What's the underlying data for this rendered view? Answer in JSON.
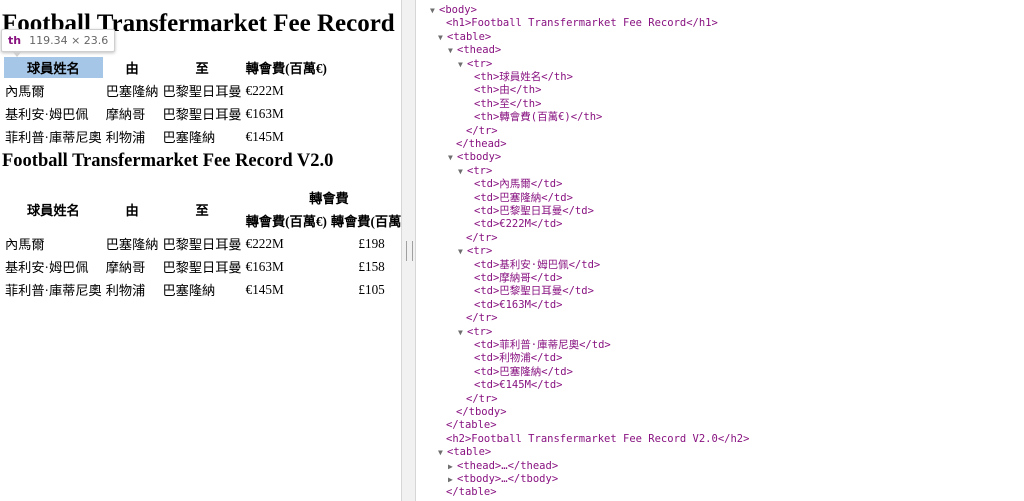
{
  "page": {
    "h1": "Football Transfermarket Fee Record",
    "h2": "Football Transfermarket Fee Record V2.0",
    "tooltip": {
      "tag": "th",
      "dims": "119.34 × 23.6"
    },
    "table1": {
      "headers": [
        "球員姓名",
        "由",
        "至",
        "轉會費(百萬€)"
      ],
      "rows": [
        [
          "內馬爾",
          "巴塞隆納",
          "巴黎聖日耳曼",
          "€222M"
        ],
        [
          "基利安·姆巴佩",
          "摩納哥",
          "巴黎聖日耳曼",
          "€163M"
        ],
        [
          "菲利普·庫蒂尼奧",
          "利物浦",
          "巴塞隆納",
          "€145M"
        ]
      ]
    },
    "table2": {
      "headers": [
        "球員姓名",
        "由",
        "至",
        "轉會費"
      ],
      "subheaders": [
        "轉會費(百萬€)",
        "轉會費(百萬£)"
      ],
      "rows": [
        [
          "內馬爾",
          "巴塞隆納",
          "巴黎聖日耳曼",
          "€222M",
          "£198"
        ],
        [
          "基利安·姆巴佩",
          "摩納哥",
          "巴黎聖日耳曼",
          "€163M",
          "£158"
        ],
        [
          "菲利普·庫蒂尼奧",
          "利物浦",
          "巴塞隆納",
          "€145M",
          "£105"
        ]
      ]
    }
  },
  "devtools": {
    "lines": [
      "<body>",
      "<h1>Football Transfermarket Fee Record</h1>",
      "<table>",
      "<thead>",
      "<tr>",
      "<th>球員姓名</th>",
      "<th>由</th>",
      "<th>至</th>",
      "<th>轉會費(百萬€)</th>",
      "</tr>",
      "</thead>",
      "<tbody>",
      "<tr>",
      "<td>內馬爾</td>",
      "<td>巴塞隆納</td>",
      "<td>巴黎聖日耳曼</td>",
      "<td>€222M</td>",
      "</tr>",
      "<tr>",
      "<td>基利安·姆巴佩</td>",
      "<td>摩納哥</td>",
      "<td>巴黎聖日耳曼</td>",
      "<td>€163M</td>",
      "</tr>",
      "<tr>",
      "<td>菲利普·庫蒂尼奧</td>",
      "<td>利物浦</td>",
      "<td>巴塞隆納</td>",
      "<td>€145M</td>",
      "</tr>",
      "</tbody>",
      "</table>",
      "<h2>Football Transfermarket Fee Record V2.0</h2>",
      "<table>",
      "<thead>…</thead>",
      "<tbody>…</tbody>",
      "</table>"
    ]
  }
}
